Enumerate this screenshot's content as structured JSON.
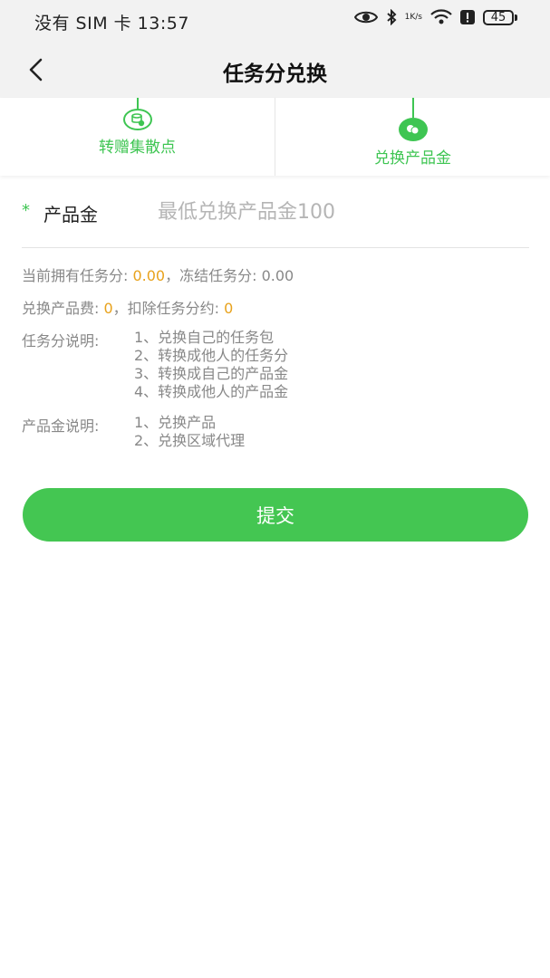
{
  "status_bar": {
    "left_text": "没有 SIM 卡 13:57",
    "net_speed_value": "1",
    "net_speed_unit": "K/s",
    "battery_level": "45"
  },
  "header": {
    "title": "任务分兑换"
  },
  "tabs": [
    {
      "label": "转赠集散点",
      "active": false
    },
    {
      "label": "兑换产品金",
      "active": true
    }
  ],
  "form": {
    "required_mark": "*",
    "field_label": "产品金",
    "input_placeholder": "最低兑换产品金100",
    "input_value": ""
  },
  "info": {
    "current_points_label": "当前拥有任务分: ",
    "current_points_value": "0.00",
    "frozen_label": "，冻结任务分: 0.00",
    "fee_label": "兑换产品费: ",
    "fee_value": "0",
    "deduct_label": "，扣除任务分约: ",
    "deduct_value": "0"
  },
  "task_points_desc": {
    "label": "任务分说明:",
    "items": [
      "1、兑换自己的任务包",
      "2、转换成他人的任务分",
      "3、转换成自己的产品金",
      "4、转换成他人的产品金"
    ]
  },
  "product_gold_desc": {
    "label": "产品金说明:",
    "items": [
      "1、兑换产品",
      "2、兑换区域代理"
    ]
  },
  "submit": {
    "label": "提交"
  },
  "colors": {
    "accent_green": "#3ec552",
    "highlight_orange": "#e8a21c",
    "header_bg": "#f2f2f2"
  }
}
